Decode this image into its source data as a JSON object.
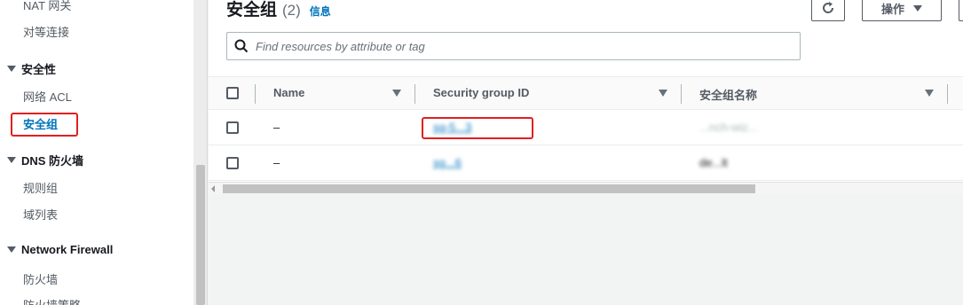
{
  "sidebar": {
    "top_items": [
      "NAT 网关",
      "对等连接"
    ],
    "sections": [
      {
        "label": "安全性",
        "items": [
          "网络 ACL",
          "安全组"
        ]
      },
      {
        "label": "DNS 防火墙",
        "items": [
          "规则组",
          "域列表"
        ]
      },
      {
        "label": "Network Firewall",
        "items": [
          "防火墙",
          "防火墙策略"
        ]
      }
    ]
  },
  "header": {
    "title": "安全组",
    "count": "(2)",
    "info_link": "信息"
  },
  "toolbar": {
    "refresh_icon": "refresh-icon",
    "actions_label": "操作"
  },
  "search": {
    "placeholder": "Find resources by attribute or tag"
  },
  "table": {
    "columns": [
      "Name",
      "Security group ID",
      "安全组名称"
    ],
    "rows": [
      {
        "name": "–",
        "id": "sg-5...3",
        "group_name": "...nch-wiz..."
      },
      {
        "name": "–",
        "id": "sg...6",
        "group_name": "de...lt"
      }
    ]
  },
  "colors": {
    "link": "#0073bb",
    "highlight": "#e02020"
  }
}
